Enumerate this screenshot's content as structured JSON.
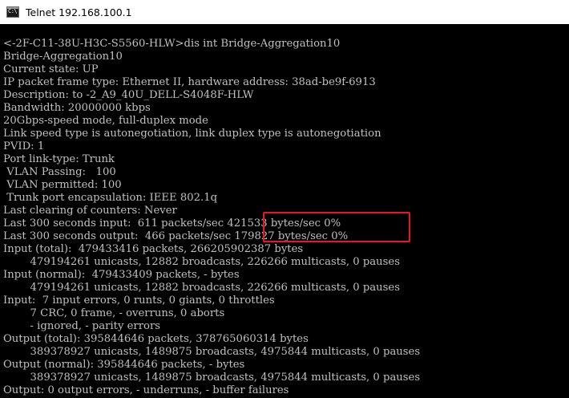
{
  "window": {
    "title": "Telnet 192.168.100.1",
    "icon": "console-icon"
  },
  "colors": {
    "terminal_background": "#000000",
    "terminal_text": "#c0c0c0",
    "annotation_box": "#e8181e"
  },
  "terminal": {
    "lines": [
      "<-2F-C11-38U-H3C-S5560-HLW>dis int Bridge-Aggregation10",
      "Bridge-Aggregation10",
      "Current state: UP",
      "IP packet frame type: Ethernet II, hardware address: 38ad-be9f-6913",
      "Description: to -2_A9_40U_DELL-S4048F-HLW",
      "Bandwidth: 20000000 kbps",
      "20Gbps-speed mode, full-duplex mode",
      "Link speed type is autonegotiation, link duplex type is autonegotiation",
      "PVID: 1",
      "Port link-type: Trunk",
      " VLAN Passing:   100",
      " VLAN permitted: 100",
      " Trunk port encapsulation: IEEE 802.1q",
      "Last clearing of counters: Never",
      "Last 300 seconds input:  611 packets/sec 421533 bytes/sec 0%",
      "Last 300 seconds output:  466 packets/sec 179827 bytes/sec 0%",
      "Input (total):  479433416 packets, 266205902387 bytes",
      "        479194261 unicasts, 12882 broadcasts, 226266 multicasts, 0 pauses",
      "Input (normal):  479433409 packets, - bytes",
      "        479194261 unicasts, 12882 broadcasts, 226266 multicasts, 0 pauses",
      "Input:  7 input errors, 0 runts, 0 giants, 0 throttles",
      "        7 CRC, 0 frame, - overruns, 0 aborts",
      "        - ignored, - parity errors",
      "Output (total): 395844646 packets, 378765060314 bytes",
      "        389378927 unicasts, 1489875 broadcasts, 4975844 multicasts, 0 pauses",
      "Output (normal): 395844646 packets, - bytes",
      "        389378927 unicasts, 1489875 broadcasts, 4975844 multicasts, 0 pauses",
      "Output: 0 output errors, - underruns, - buffer failures"
    ]
  }
}
